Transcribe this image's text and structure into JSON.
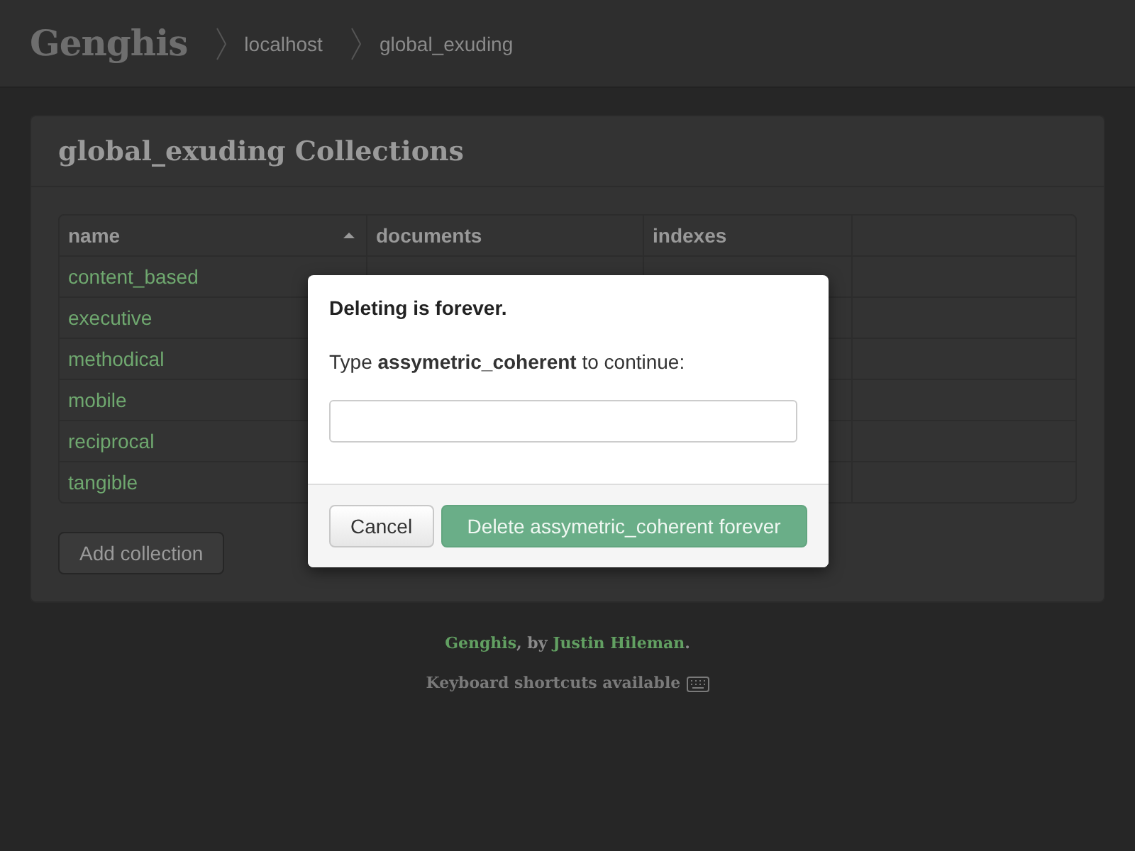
{
  "header": {
    "logo": "Genghis",
    "breadcrumbs": [
      "localhost",
      "global_exuding"
    ]
  },
  "card": {
    "title": "global_exuding Collections",
    "table": {
      "columns": [
        {
          "label": "name",
          "sorted": true
        },
        {
          "label": "documents",
          "sorted": false
        },
        {
          "label": "indexes",
          "sorted": false
        }
      ],
      "rows": [
        {
          "name": "content_based"
        },
        {
          "name": "executive"
        },
        {
          "name": "methodical"
        },
        {
          "name": "mobile"
        },
        {
          "name": "reciprocal"
        },
        {
          "name": "tangible"
        }
      ]
    },
    "add_button": "Add collection"
  },
  "footer": {
    "app_link": "Genghis",
    "by": ", by ",
    "author_link": "Justin Hileman",
    "end": ".",
    "shortcuts": "Keyboard shortcuts available"
  },
  "modal": {
    "title": "Deleting is forever.",
    "message": "Type **assymetric_coherent** to continue:",
    "buttons": [
      {
        "label": "Cancel",
        "kind": "default"
      },
      {
        "label": "Delete assymetric_coherent forever",
        "kind": "danger"
      }
    ]
  }
}
